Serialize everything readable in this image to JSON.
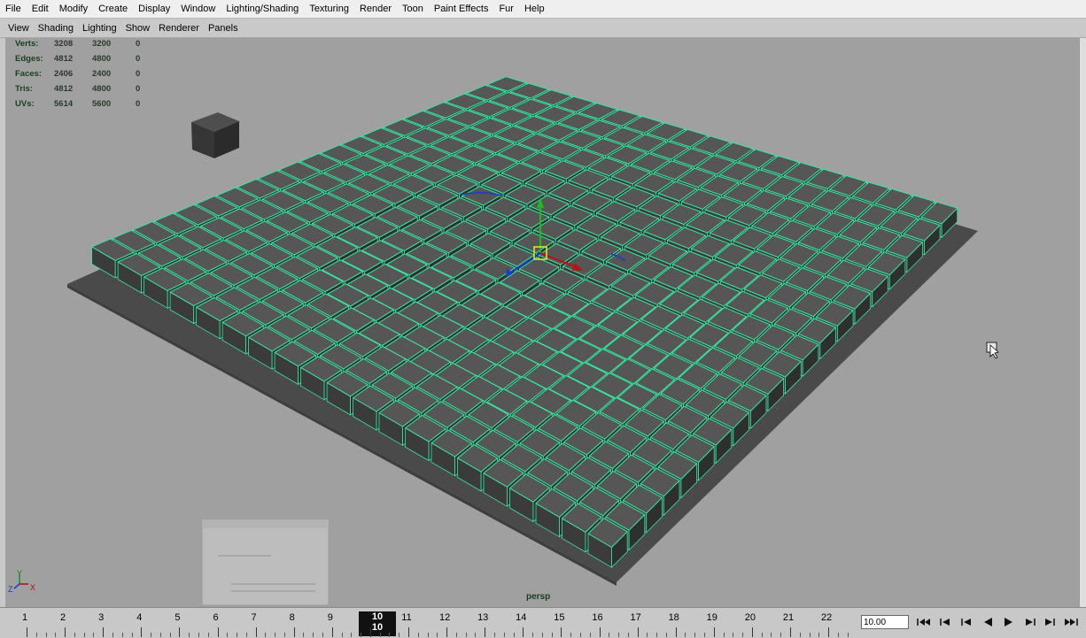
{
  "menubar": {
    "items": [
      "File",
      "Edit",
      "Modify",
      "Create",
      "Display",
      "Window",
      "Lighting/Shading",
      "Texturing",
      "Render",
      "Toon",
      "Paint Effects",
      "Fur",
      "Help"
    ]
  },
  "panel_menu": {
    "items": [
      "View",
      "Shading",
      "Lighting",
      "Show",
      "Renderer",
      "Panels"
    ]
  },
  "hud": {
    "rows": [
      {
        "label": "Verts:",
        "v1": "3208",
        "v2": "3200",
        "v3": "0"
      },
      {
        "label": "Edges:",
        "v1": "4812",
        "v2": "4800",
        "v3": "0"
      },
      {
        "label": "Faces:",
        "v1": "2406",
        "v2": "2400",
        "v3": "0"
      },
      {
        "label": "Tris:",
        "v1": "4812",
        "v2": "4800",
        "v3": "0"
      },
      {
        "label": "UVs:",
        "v1": "5614",
        "v2": "5600",
        "v3": "0"
      }
    ]
  },
  "viewport": {
    "camera": "persp",
    "axis": {
      "y": "Y",
      "z": "Z",
      "x": "X"
    },
    "colors": {
      "background": "#a0a0a0",
      "cube_top": "#565656",
      "wire": "#37e6a0",
      "base": "#4a4a4a"
    }
  },
  "timeline": {
    "frames": [
      "1",
      "2",
      "3",
      "4",
      "5",
      "6",
      "7",
      "8",
      "9",
      "10",
      "11",
      "12",
      "13",
      "14",
      "15",
      "16",
      "17",
      "18",
      "19",
      "20",
      "21",
      "22"
    ],
    "current_frame": "10",
    "current_frame_value": "10.00"
  },
  "playback": {
    "icons": [
      "go-to-start-icon",
      "step-back-key-icon",
      "step-back-frame-icon",
      "play-backward-icon",
      "play-forward-icon",
      "step-forward-frame-icon",
      "step-forward-key-icon",
      "go-to-end-icon"
    ]
  }
}
